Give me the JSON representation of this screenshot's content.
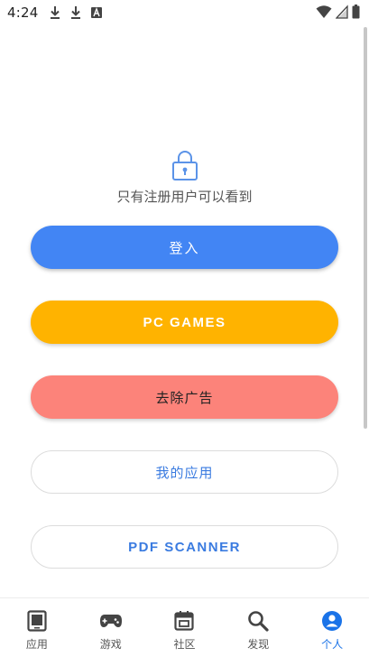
{
  "status_bar": {
    "time": "4:24",
    "left_icons": [
      "download-icon",
      "download-icon",
      "font-a-icon"
    ],
    "right_icons": [
      "wifi-icon",
      "signal-icon",
      "battery-icon"
    ]
  },
  "locked_notice": {
    "icon": "lock-icon",
    "text": "只有注册用户可以看到"
  },
  "buttons": {
    "login": "登入",
    "pc_games": "PC GAMES",
    "remove_ads": "去除广告",
    "my_apps": "我的应用",
    "pdf_scanner": "PDF SCANNER"
  },
  "bottom_nav": {
    "items": [
      {
        "label": "应用",
        "icon": "apps-icon"
      },
      {
        "label": "游戏",
        "icon": "gamepad-icon"
      },
      {
        "label": "社区",
        "icon": "community-icon"
      },
      {
        "label": "发现",
        "icon": "search-icon"
      },
      {
        "label": "个人",
        "icon": "profile-icon"
      }
    ],
    "active_index": 4
  },
  "colors": {
    "primary": "#4285f4",
    "pc_games": "#ffb300",
    "remove_ads": "#fc837a",
    "link_text": "#3a7be0",
    "active_nav": "#1a73e8"
  }
}
